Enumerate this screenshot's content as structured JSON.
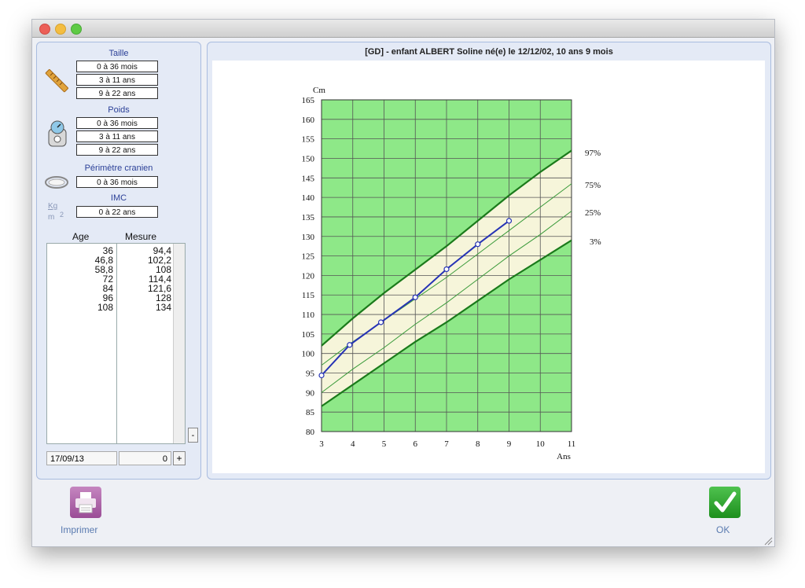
{
  "sidebar": {
    "taille": {
      "title": "Taille",
      "ranges": [
        "0 à 36 mois",
        "3 à 11 ans",
        "9 à 22 ans"
      ]
    },
    "poids": {
      "title": "Poids",
      "ranges": [
        "0 à 36 mois",
        "3 à 11 ans",
        "9 à 22 ans"
      ]
    },
    "perimetre": {
      "title": "Périmètre cranien",
      "ranges": [
        "0 à 36 mois"
      ]
    },
    "imc": {
      "title": "IMC",
      "icon_text_top": "Kg",
      "icon_text_bottom": "m",
      "icon_exp": "2",
      "ranges": [
        "0 à 22 ans"
      ]
    },
    "table": {
      "col_age": "Age",
      "col_mesure": "Mesure",
      "rows": [
        {
          "age": "36",
          "mesure": "94,4"
        },
        {
          "age": "46,8",
          "mesure": "102,2"
        },
        {
          "age": "58,8",
          "mesure": "108"
        },
        {
          "age": "72",
          "mesure": "114,4"
        },
        {
          "age": "84",
          "mesure": "121,6"
        },
        {
          "age": "96",
          "mesure": "128"
        },
        {
          "age": "108",
          "mesure": "134"
        }
      ]
    },
    "minus_label": "-",
    "date_value": "17/09/13",
    "number_value": "0",
    "plus_label": "+"
  },
  "header": {
    "title": "[GD] - enfant ALBERT Soline   né(e) le 12/12/02, 10 ans 9 mois"
  },
  "buttons": {
    "print_label": "Imprimer",
    "ok_label": "OK"
  },
  "colors": {
    "zone_green": "#8ee888",
    "band_cream": "#f6f5da",
    "curve_dark": "#1b7a1b",
    "curve_light": "#3a9a3a",
    "patient_line": "#2633b5"
  },
  "chart_data": {
    "type": "line",
    "ylabel": "Cm",
    "xlabel": "Ans",
    "xlim": [
      3,
      11
    ],
    "ylim": [
      80,
      165
    ],
    "xticks": [
      3,
      4,
      5,
      6,
      7,
      8,
      9,
      10,
      11
    ],
    "yticks": [
      80,
      85,
      90,
      95,
      100,
      105,
      110,
      115,
      120,
      125,
      130,
      135,
      140,
      145,
      150,
      155,
      160,
      165
    ],
    "grid": true,
    "percentiles": [
      {
        "name": "97%",
        "x": [
          3,
          4,
          5,
          6,
          7,
          8,
          9,
          10,
          11
        ],
        "y": [
          102,
          109,
          115.5,
          121.5,
          127.5,
          134,
          140.5,
          146.5,
          152
        ]
      },
      {
        "name": "75%",
        "x": [
          3,
          4,
          5,
          6,
          7,
          8,
          9,
          10,
          11
        ],
        "y": [
          97,
          103,
          108.5,
          114,
          119.5,
          125.5,
          131.5,
          137.5,
          143.5
        ]
      },
      {
        "name": "25%",
        "x": [
          3,
          4,
          5,
          6,
          7,
          8,
          9,
          10,
          11
        ],
        "y": [
          90,
          96,
          101.5,
          107.5,
          113,
          119,
          125,
          130.5,
          136.5
        ]
      },
      {
        "name": "3%",
        "x": [
          3,
          4,
          5,
          6,
          7,
          8,
          9,
          10,
          11
        ],
        "y": [
          86.5,
          92,
          97.5,
          103,
          108,
          113.5,
          119,
          124,
          129
        ]
      }
    ],
    "series": [
      {
        "x": [
          3,
          3.9,
          4.9,
          6,
          7,
          8,
          9
        ],
        "y": [
          94.4,
          102.2,
          108,
          114.4,
          121.6,
          128,
          134
        ]
      }
    ]
  }
}
